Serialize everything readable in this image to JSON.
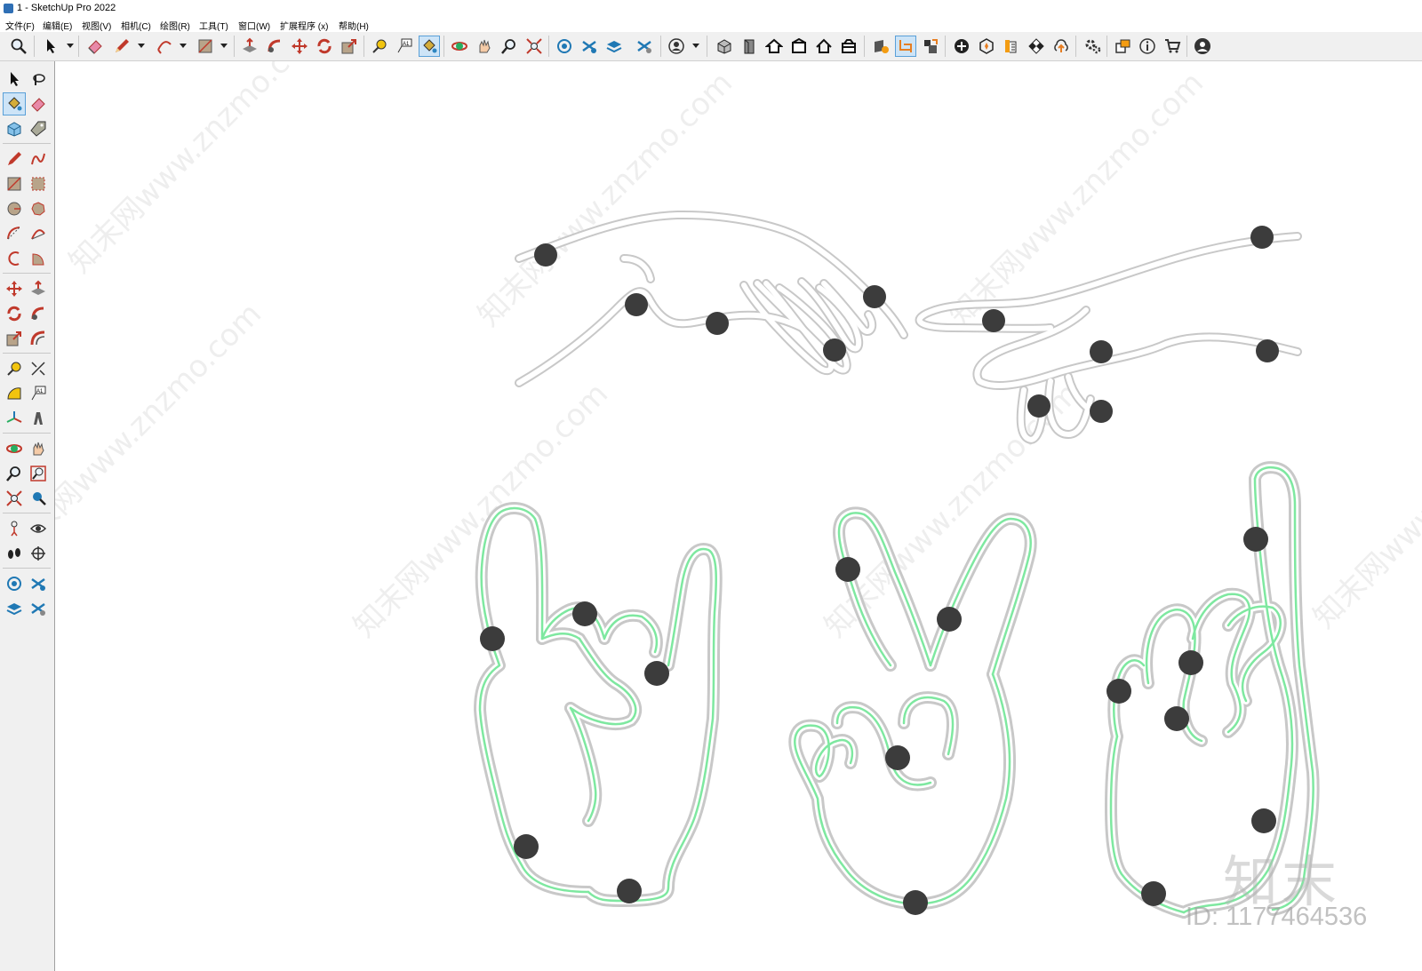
{
  "window": {
    "title": "1 - SketchUp Pro 2022"
  },
  "menu": [
    {
      "label": "文件(F)"
    },
    {
      "label": "编辑(E)"
    },
    {
      "label": "视图(V)"
    },
    {
      "label": "相机(C)"
    },
    {
      "label": "绘图(R)"
    },
    {
      "label": "工具(T)"
    },
    {
      "label": "窗口(W)"
    },
    {
      "label": "扩展程序 (x)"
    },
    {
      "label": "帮助(H)"
    }
  ],
  "toolbar": {
    "tools": [
      {
        "icon": "zoom-icon"
      },
      {
        "icon": "select-arrow-icon"
      },
      {
        "icon": "eraser-icon"
      },
      {
        "icon": "pencil-icon"
      },
      {
        "icon": "arc-icon"
      },
      {
        "icon": "rectangle-icon"
      },
      {
        "icon": "push-pull-icon"
      },
      {
        "icon": "follow-me-icon"
      },
      {
        "icon": "move-icon"
      },
      {
        "icon": "rotate-icon"
      },
      {
        "icon": "scale-icon"
      },
      {
        "icon": "tape-measure-icon"
      },
      {
        "icon": "text-icon"
      },
      {
        "icon": "paint-bucket-icon"
      },
      {
        "icon": "orbit-icon"
      },
      {
        "icon": "pan-icon"
      },
      {
        "icon": "zoom-tool-icon"
      },
      {
        "icon": "zoom-extents-icon"
      },
      {
        "icon": "warehouse-icon"
      },
      {
        "icon": "extension-icon"
      },
      {
        "icon": "layers-icon"
      },
      {
        "icon": "scenes-icon"
      },
      {
        "icon": "account-icon"
      },
      {
        "icon": "iso-view-icon"
      },
      {
        "icon": "top-view-icon"
      },
      {
        "icon": "front-view-icon"
      },
      {
        "icon": "right-view-icon"
      },
      {
        "icon": "back-view-icon"
      },
      {
        "icon": "left-view-icon"
      },
      {
        "icon": "section-plane-icon"
      },
      {
        "icon": "display-section-icon"
      },
      {
        "icon": "section-cut-icon"
      },
      {
        "icon": "add-icon"
      },
      {
        "icon": "solid-icon"
      },
      {
        "icon": "style-icon"
      },
      {
        "icon": "checker-icon"
      },
      {
        "icon": "cloud-upload-icon"
      },
      {
        "icon": "settings-icon"
      },
      {
        "icon": "window-icon"
      },
      {
        "icon": "info-icon"
      },
      {
        "icon": "cart-icon"
      },
      {
        "icon": "profile-icon"
      }
    ]
  },
  "left_tools": [
    {
      "icon": "select-icon"
    },
    {
      "icon": "lasso-icon"
    },
    {
      "icon": "paint-bucket-icon"
    },
    {
      "icon": "eraser-icon"
    },
    {
      "icon": "make-component-icon"
    },
    {
      "icon": "tag-icon"
    },
    {
      "icon": "pencil-icon"
    },
    {
      "icon": "freehand-icon"
    },
    {
      "icon": "rectangle-icon"
    },
    {
      "icon": "rotated-rect-icon"
    },
    {
      "icon": "circle-icon"
    },
    {
      "icon": "polygon-icon"
    },
    {
      "icon": "arc-icon"
    },
    {
      "icon": "arc-2pt-icon"
    },
    {
      "icon": "arc-3pt-icon"
    },
    {
      "icon": "pie-icon"
    },
    {
      "icon": "move-icon"
    },
    {
      "icon": "push-pull-icon"
    },
    {
      "icon": "rotate-icon"
    },
    {
      "icon": "follow-me-icon"
    },
    {
      "icon": "scale-icon"
    },
    {
      "icon": "offset-icon"
    },
    {
      "icon": "tape-measure-icon"
    },
    {
      "icon": "dimension-icon"
    },
    {
      "icon": "protractor-icon"
    },
    {
      "icon": "text-icon"
    },
    {
      "icon": "axes-icon"
    },
    {
      "icon": "3d-text-icon"
    },
    {
      "icon": "orbit-icon"
    },
    {
      "icon": "pan-icon"
    },
    {
      "icon": "zoom-icon"
    },
    {
      "icon": "zoom-window-icon"
    },
    {
      "icon": "zoom-extents-icon"
    },
    {
      "icon": "previous-view-icon"
    },
    {
      "icon": "position-camera-icon"
    },
    {
      "icon": "look-around-icon"
    },
    {
      "icon": "walk-icon"
    },
    {
      "icon": "section-plane-icon"
    },
    {
      "icon": "warehouse-icon"
    },
    {
      "icon": "extension-icon"
    },
    {
      "icon": "layers-icon"
    },
    {
      "icon": "share-icon"
    }
  ],
  "watermark": {
    "logo": "知末",
    "id": "ID: 1177464536",
    "site": "知末网www.znzmo.com"
  },
  "colors": {
    "neon_core": "#7ee8a0",
    "tube_outline": "#c8c8c8",
    "tube_fill": "#ffffff",
    "mount_dot": "#3c3c3c",
    "active_tool": "#cde4f7"
  }
}
